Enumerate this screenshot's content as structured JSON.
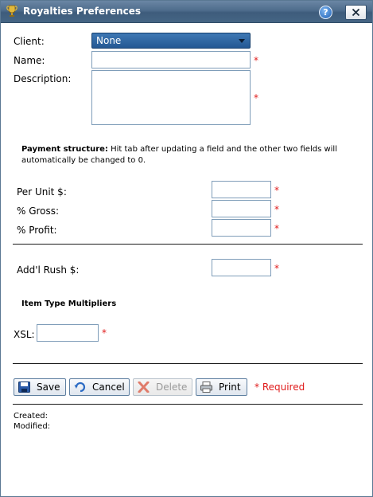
{
  "window": {
    "title": "Royalties Preferences",
    "help_icon": "?"
  },
  "form": {
    "client_label": "Client:",
    "client_value": "None",
    "name_label": "Name:",
    "description_label": "Description:",
    "required_mark": "*",
    "payment_note_bold": "Payment structure:",
    "payment_note_text": " Hit tab after updating a field and the other two fields will automatically be changed to 0.",
    "per_unit_label": "Per Unit $:",
    "gross_label": "% Gross:",
    "profit_label": "% Profit:",
    "rush_label": "Add'l Rush $:",
    "multipliers_title": "Item Type Multipliers",
    "xsl_label": "XSL:"
  },
  "buttons": {
    "save": "Save",
    "cancel": "Cancel",
    "delete": "Delete",
    "print": "Print",
    "required_note": "* Required"
  },
  "footer": {
    "created_label": "Created:",
    "modified_label": "Modified:"
  },
  "colors": {
    "titlebar": "#4e6c8c",
    "required": "#e01b1b",
    "select_bg": "#2f66a3"
  }
}
